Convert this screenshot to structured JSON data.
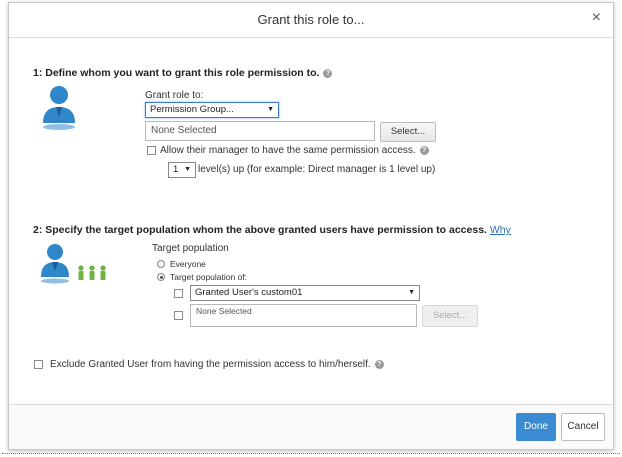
{
  "dialog": {
    "title": "Grant this role to...",
    "close": "×"
  },
  "section1": {
    "title": "1: Define whom you want to grant this role permission to.",
    "grant_label": "Grant role to:",
    "grant_value": "Permission Group...",
    "none_selected": "None Selected",
    "select_button": "Select...",
    "allow_manager": "Allow their manager to have the same permission access.",
    "level_value": "1",
    "level_text": "level(s) up (for example: Direct manager is 1 level up)"
  },
  "section2": {
    "title": "2: Specify the target population whom the above granted users have permission to access.",
    "why_link": "Why",
    "target_label": "Target population",
    "everyone": "Everyone",
    "target_of": "Target population of:",
    "custom_value": "Granted User's custom01",
    "none_selected": "None Selected",
    "select_button": "Select..."
  },
  "exclude": "Exclude Granted User from having the permission access to him/herself.",
  "footer": {
    "done": "Done",
    "cancel": "Cancel"
  },
  "colors": {
    "accent": "#3a8bd1",
    "icon_blue": "#2f86c8",
    "icon_green": "#6cb33f"
  }
}
